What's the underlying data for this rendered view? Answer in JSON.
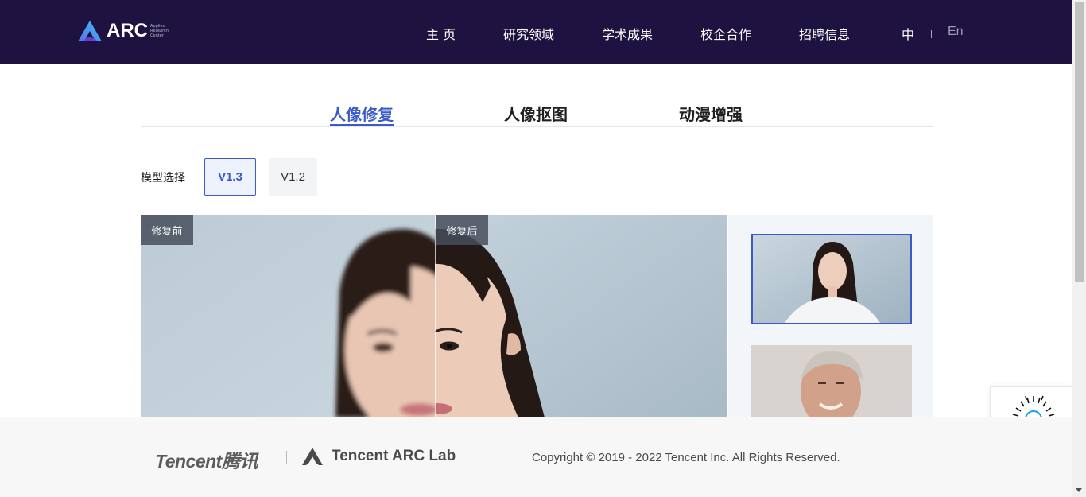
{
  "header": {
    "logo_text": "ARC",
    "logo_sub": [
      "Applied",
      "Research",
      "Center"
    ],
    "nav": [
      "主 页",
      "研究领域",
      "学术成果",
      "校企合作",
      "招聘信息"
    ],
    "lang_zh": "中",
    "lang_en": "En"
  },
  "tabs": {
    "items": [
      "人像修复",
      "人像抠图",
      "动漫增强"
    ],
    "active": "人像修复"
  },
  "model": {
    "label": "模型选择",
    "versions": [
      "V1.3",
      "V1.2"
    ],
    "selected": "V1.3"
  },
  "compare": {
    "before_label": "修复前",
    "after_label": "修复后"
  },
  "footer": {
    "tencent_logo": "Tencent腾讯",
    "arc_lab": "Tencent  ARC Lab",
    "copyright": "Copyright © 2019 - 2022 Tencent Inc. All Rights Reserved."
  },
  "colors": {
    "header_bg": "#1d1240",
    "accent": "#3a5bc7",
    "footer_bg": "#f7f7f8"
  }
}
